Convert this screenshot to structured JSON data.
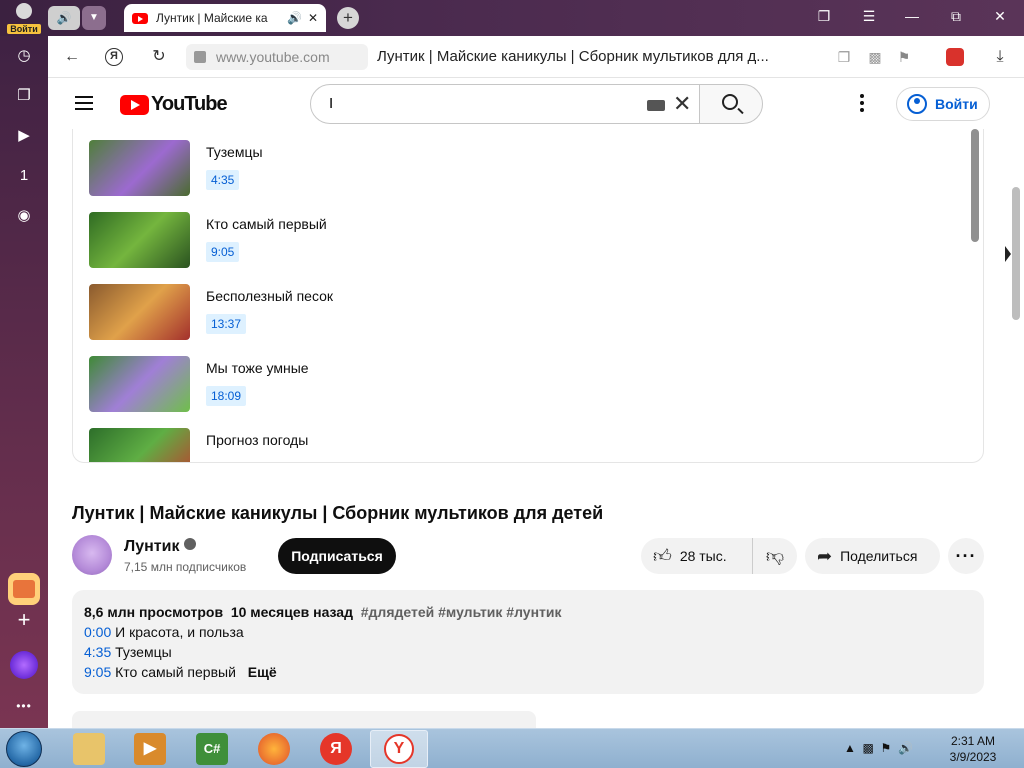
{
  "browser": {
    "account_label": "Войти",
    "active_tab_title": "Лунтик | Майские ка",
    "url": "www.youtube.com",
    "page_title": "Лунтик | Майские каникулы | Сборник мультиков для д..."
  },
  "youtube": {
    "logo_text": "YouTube",
    "search_value": "I",
    "signin_label": "Войти"
  },
  "chapters": [
    {
      "title": "Туземцы",
      "time": "4:35",
      "thumb_color": "#6b9a4e"
    },
    {
      "title": "Кто самый первый",
      "time": "9:05",
      "thumb_color": "#3e7c2a"
    },
    {
      "title": "Бесполезный песок",
      "time": "13:37",
      "thumb_color": "#c9873d"
    },
    {
      "title": "Мы тоже умные",
      "time": "18:09",
      "thumb_color": "#5fa84c"
    },
    {
      "title": "Прогноз погоды",
      "time": "",
      "thumb_color": "#3d8f35"
    }
  ],
  "video": {
    "title": "Лунтик | Майские каникулы | Сборник мультиков для детей",
    "channel_name": "Лунтик",
    "subscribers": "7,15 млн подписчиков",
    "subscribe_label": "Подписаться",
    "likes": "28 тыс.",
    "share_label": "Поделиться"
  },
  "description": {
    "views": "8,6 млн просмотров",
    "date": "10 месяцев назад",
    "tags": "#длядетей #мультик #лунтик",
    "lines": [
      {
        "time": "0:00",
        "text": "И красота, и польза"
      },
      {
        "time": "4:35",
        "text": "Туземцы"
      },
      {
        "time": "9:05",
        "text": "Кто самый первый"
      }
    ],
    "more_label": "Ещё"
  },
  "taskbar": {
    "time": "2:31 AM",
    "date": "3/9/2023"
  },
  "colors": {
    "link_blue": "#065fd4",
    "yt_red": "#ff0000",
    "browser_purple": "#4a2a4e"
  }
}
